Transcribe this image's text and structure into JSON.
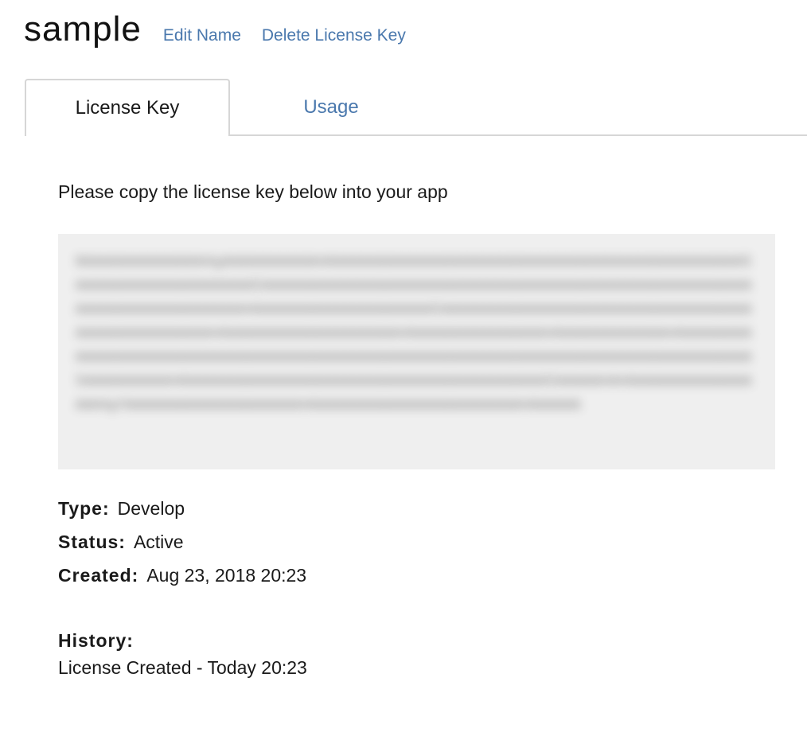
{
  "header": {
    "title": "sample",
    "edit_name_link": "Edit Name",
    "delete_link": "Delete License Key"
  },
  "tabs": [
    {
      "label": "License Key",
      "active": true
    },
    {
      "label": "Usage",
      "active": false
    }
  ],
  "license": {
    "instruction": "Please copy the license key below into your app",
    "key_text": "",
    "key_obscured": true
  },
  "details": {
    "type_label": "Type:",
    "type_value": "Develop",
    "status_label": "Status:",
    "status_value": "Active",
    "created_label": "Created:",
    "created_value": "Aug 23, 2018 20:23"
  },
  "history": {
    "label": "History:",
    "items": [
      "License Created - Today 20:23"
    ]
  },
  "colors": {
    "link": "#4a78ad",
    "key_box_bg": "#efefef",
    "tab_border": "#d6d6d6"
  }
}
